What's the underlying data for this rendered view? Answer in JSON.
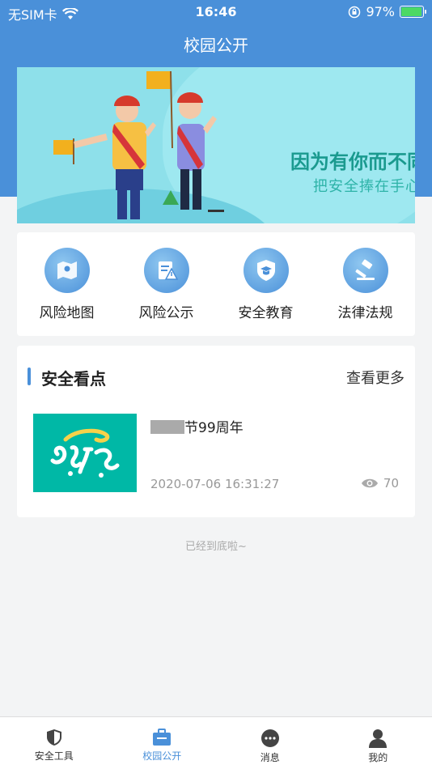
{
  "status_bar": {
    "carrier": "无SIM卡",
    "time": "16:46",
    "battery": "97%",
    "battery_level": 0.97
  },
  "header": {
    "title": "校园公开"
  },
  "banner": {
    "headline": "因为有你而不同",
    "subline": "把安全捧在手心"
  },
  "quick_links": [
    {
      "label": "风险地图",
      "icon": "map-icon"
    },
    {
      "label": "风险公示",
      "icon": "notice-warning-icon"
    },
    {
      "label": "安全教育",
      "icon": "shield-graduation-icon"
    },
    {
      "label": "法律法规",
      "icon": "gavel-icon"
    }
  ],
  "news": {
    "section_title": "安全看点",
    "more_label": "查看更多",
    "items": [
      {
        "title_suffix": "节99周年",
        "date": "2020-07-06 16:31:27",
        "views": "70"
      }
    ]
  },
  "end_text": "已经到底啦~",
  "tabs": [
    {
      "label": "安全工具",
      "icon": "shield-icon",
      "active": false
    },
    {
      "label": "校园公开",
      "icon": "briefcase-icon",
      "active": true
    },
    {
      "label": "消息",
      "icon": "chat-bubble-icon",
      "active": false
    },
    {
      "label": "我的",
      "icon": "user-icon",
      "active": false
    }
  ],
  "colors": {
    "primary": "#4a90d9",
    "banner_text": "#1a9a8f",
    "thumb": "#00b8a6"
  }
}
